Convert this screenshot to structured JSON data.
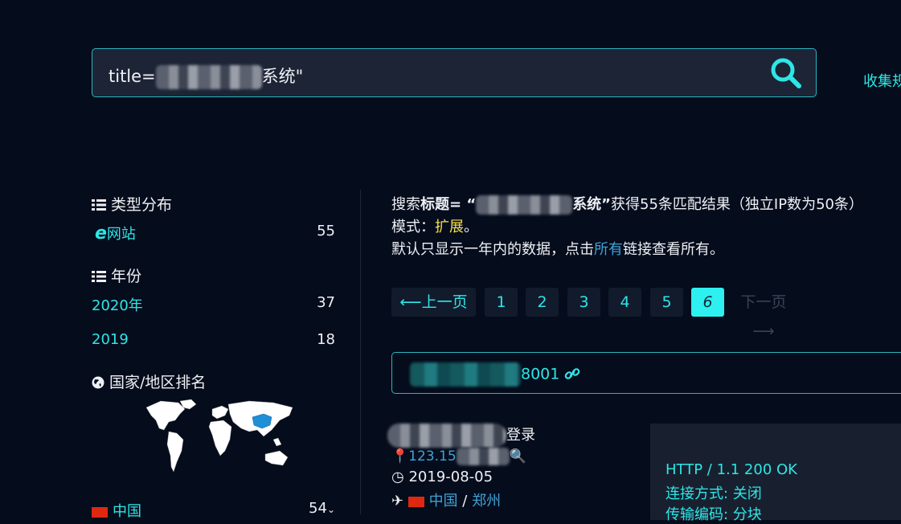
{
  "search": {
    "query_prefix": "title=",
    "query_suffix": "系统\""
  },
  "header": {
    "collect_link": "收集规"
  },
  "sidebar": {
    "type_dist": {
      "title": "类型分布",
      "items": [
        {
          "label": "网站",
          "count": "55"
        }
      ]
    },
    "year": {
      "title": "年份",
      "items": [
        {
          "label": "2020年",
          "count": "37"
        },
        {
          "label": "2019",
          "count": "18"
        }
      ]
    },
    "country": {
      "title": "国家/地区排名",
      "items": [
        {
          "label": "中国",
          "count": "54"
        }
      ]
    }
  },
  "results": {
    "summary_prefix": "搜索",
    "summary_field": "标题",
    "summary_eq": "= “",
    "summary_term_suffix": "系统”",
    "summary_tail": "获得55条匹配结果（独立IP数为50条）",
    "mode_label": "模式：",
    "mode_value": "扩展",
    "mode_end": "。",
    "note_prefix": "默认只显示一年内的数据，点击",
    "note_link": "所有",
    "note_suffix": "链接查看所有。"
  },
  "pagination": {
    "prev": "⟵上一页",
    "pages": [
      "1",
      "2",
      "3",
      "4",
      "5",
      "6"
    ],
    "current": "6",
    "next": "下一页⟶"
  },
  "result_card": {
    "url_suffix": "8001"
  },
  "result_item": {
    "title_suffix": "登录",
    "ip_prefix": "123.15",
    "date": "2019-08-05",
    "country": "中国",
    "city": "郑州",
    "separator": "/"
  },
  "http_detail": {
    "status": "HTTP / 1.1 200 OK",
    "connection": "连接方式: 关闭",
    "transfer": "传输编码: 分块"
  },
  "colors": {
    "accent": "#2ee6e6",
    "background": "#050c1c",
    "highlight": "#f5e04a"
  }
}
